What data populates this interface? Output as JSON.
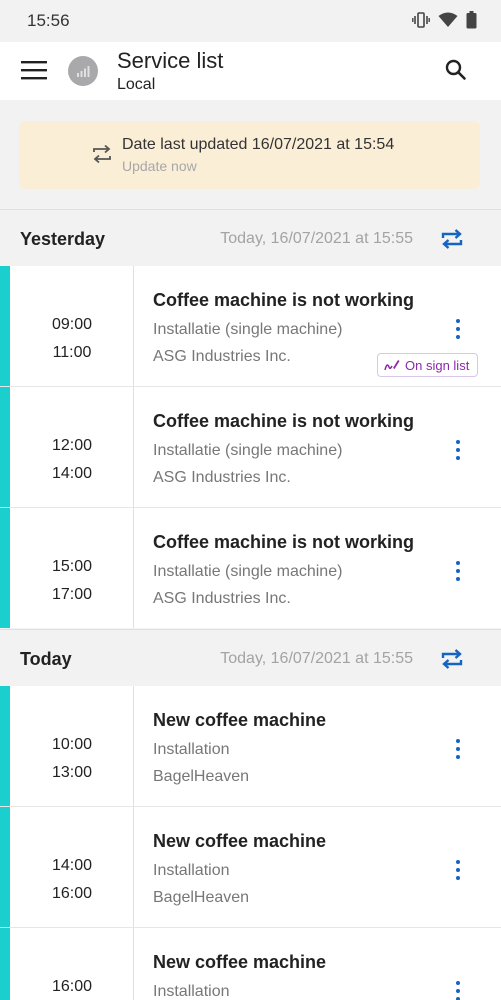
{
  "status_bar": {
    "time": "15:56"
  },
  "app_bar": {
    "title": "Service list",
    "subtitle": "Local"
  },
  "update_banner": {
    "text": "Date last updated 16/07/2021 at 15:54",
    "link": "Update now"
  },
  "sections": [
    {
      "title": "Yesterday",
      "date": "Today, 16/07/2021 at 15:55",
      "rows": [
        {
          "start": "09:00",
          "end": "11:00",
          "title": "Coffee machine is not working",
          "type": "Installatie (single machine)",
          "company": "ASG Industries Inc.",
          "badge": "On sign list"
        },
        {
          "start": "12:00",
          "end": "14:00",
          "title": "Coffee machine is not working",
          "type": "Installatie (single machine)",
          "company": "ASG Industries Inc."
        },
        {
          "start": "15:00",
          "end": "17:00",
          "title": "Coffee machine is not working",
          "type": "Installatie (single machine)",
          "company": "ASG Industries Inc."
        }
      ]
    },
    {
      "title": "Today",
      "date": "Today, 16/07/2021 at 15:55",
      "rows": [
        {
          "start": "10:00",
          "end": "13:00",
          "title": "New coffee machine",
          "type": "Installation",
          "company": "BagelHeaven"
        },
        {
          "start": "14:00",
          "end": "16:00",
          "title": "New coffee machine",
          "type": "Installation",
          "company": "BagelHeaven"
        },
        {
          "start": "16:00",
          "end": "",
          "title": "New coffee machine",
          "type": "Installation",
          "company": ""
        }
      ]
    }
  ],
  "colors": {
    "accent_bar": "#1ccfcf",
    "sync_icon": "#1565c0",
    "banner_bg": "#fbeed6",
    "badge_text": "#8a2aa8"
  },
  "icons": {
    "menu": "hamburger-menu-icon",
    "avatar": "signal-bars-icon",
    "search": "search-icon",
    "update": "sync-arrows-icon",
    "sync": "sync-arrows-icon",
    "more": "more-vertical-icon",
    "sign": "signature-pen-icon"
  }
}
